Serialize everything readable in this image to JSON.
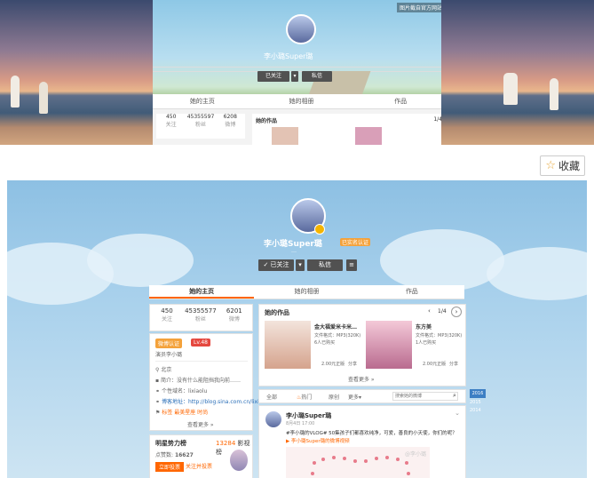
{
  "top_screenshot": {
    "watermark": "图片截自官方网站",
    "profile_name": "李小璐Super璐",
    "tabs": [
      "她的主页",
      "她的相册",
      "作品"
    ],
    "follow_btn": "已关注",
    "message_btn": "私信",
    "stats": [
      {
        "value": "450",
        "label": "关注"
      },
      {
        "value": "45355597",
        "label": "粉丝"
      },
      {
        "value": "6208",
        "label": "微博"
      }
    ],
    "works_title": "她的作品",
    "works_page": "1/4"
  },
  "favorite": {
    "icon": "star-icon",
    "label": "收藏"
  },
  "profile": {
    "name": "李小璐Super璐",
    "verified_tag": "已实名认证",
    "subtitle": "…",
    "follow_label": "已关注",
    "message_label": "私信",
    "tabs": [
      "她的主页",
      "她的相册",
      "作品"
    ],
    "stats": [
      {
        "value": "450",
        "label": "关注"
      },
      {
        "value": "45355577",
        "label": "粉丝"
      },
      {
        "value": "6201",
        "label": "微博"
      }
    ],
    "vip_badge": "微博认证",
    "vip_level": "Lv.48",
    "intro": "演员李小璐",
    "info": [
      {
        "icon": "location-icon",
        "text": "北京"
      },
      {
        "icon": "info-icon",
        "text": "简介：没有什么能阻挡我向前……"
      },
      {
        "icon": "link-icon",
        "text": "个性域名：lixiaolu"
      },
      {
        "icon": "link-icon",
        "text": "博客地址：http://blog.sina.com.cn/lixiaolu"
      },
      {
        "icon": "tag-icon",
        "text": "标签 最美星座 时尚"
      }
    ],
    "see_more": "查看更多 »",
    "power_title": "明星势力榜",
    "power_score": "13284",
    "power_rank_label": "影视榜",
    "power_count": "16627",
    "power_sub": "点赞数",
    "power_btn": "立即投票",
    "power_btn2": "关注并投票"
  },
  "works": {
    "title": "她的作品",
    "page": "1/4",
    "items": [
      {
        "title": "金大福爱米卡米…",
        "meta1": "文件格式：MP3(320K)",
        "meta2": "6人已购买",
        "price": "2.00元正版",
        "share": "分享"
      },
      {
        "title": "东方美",
        "meta1": "文件格式：MP3(320K)",
        "meta2": "1人已购买",
        "price": "2.00元正版",
        "share": "分享"
      }
    ],
    "see_more": "查看更多 »"
  },
  "feed": {
    "filters": [
      "全部",
      "热门",
      "原创",
      "更多"
    ],
    "search_placeholder": "搜索她的微博",
    "side_tab": "2016",
    "side_years": [
      "2015",
      "2014"
    ],
    "post": {
      "author": "李小璐Super璐",
      "time": "8月4日 17:00",
      "text1": "#李小璐的VLOG# 50集孩子们都喜欢纯净，可爱，善良的小天使，你们的呢？",
      "text2": "李小璐Super璐的微博视频",
      "watermark": "@李小璐"
    }
  }
}
